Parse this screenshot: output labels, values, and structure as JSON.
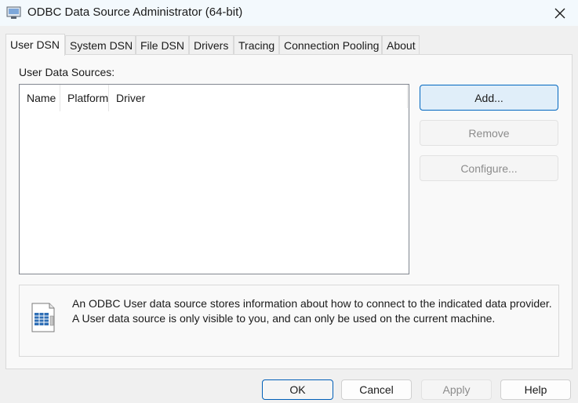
{
  "window": {
    "title": "ODBC Data Source Administrator (64-bit)"
  },
  "tabs": [
    {
      "label": "User DSN",
      "active": true
    },
    {
      "label": "System DSN"
    },
    {
      "label": "File DSN"
    },
    {
      "label": "Drivers"
    },
    {
      "label": "Tracing"
    },
    {
      "label": "Connection Pooling"
    },
    {
      "label": "About"
    }
  ],
  "user_dsn": {
    "section_label": "User Data Sources:",
    "columns": [
      "Name",
      "Platform",
      "Driver"
    ],
    "rows": [],
    "buttons": {
      "add": "Add...",
      "remove": "Remove",
      "configure": "Configure..."
    },
    "info_text": "An ODBC User data source stores information about how to connect to the indicated data provider.   A User data source is only visible to you, and can only be used on the current machine."
  },
  "footer": {
    "ok": "OK",
    "cancel": "Cancel",
    "apply": "Apply",
    "help": "Help"
  },
  "icons": {
    "app": "odbc-admin-icon",
    "close": "close-icon",
    "info": "datasource-document-icon"
  },
  "colors": {
    "accent": "#005fb8",
    "focus_button_bg": "#e0eef9",
    "disabled_text": "#8c8c8c"
  }
}
